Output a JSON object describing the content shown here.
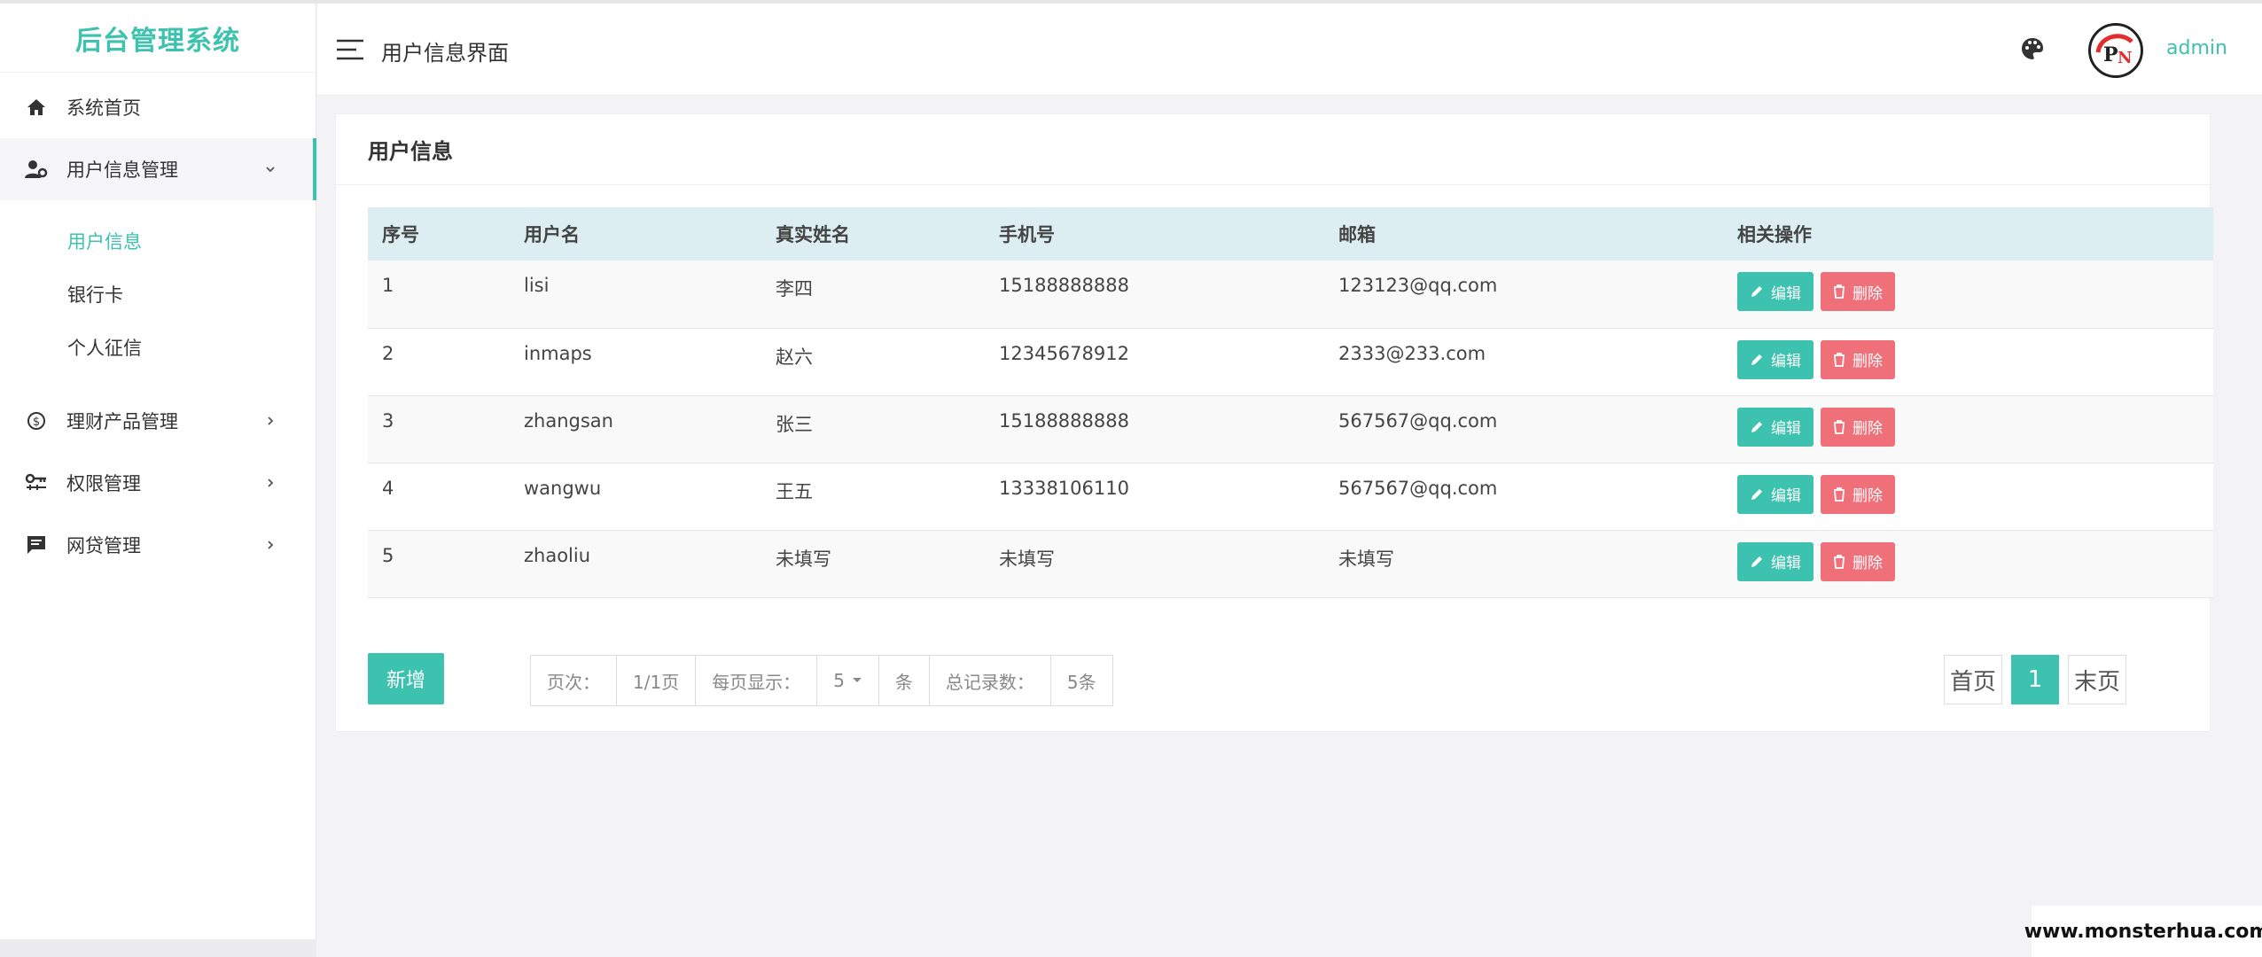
{
  "app": {
    "logo": "后台管理系统"
  },
  "colors": {
    "accent": "#3cc2ae",
    "danger": "#f0707a",
    "table_header": "#dceef2"
  },
  "sidebar": {
    "items": [
      {
        "label": "系统首页",
        "icon": "home-icon"
      },
      {
        "label": "用户信息管理",
        "icon": "user-settings-icon",
        "open": true,
        "children": [
          "用户信息",
          "银行卡",
          "个人征信"
        ],
        "active_child": "用户信息"
      },
      {
        "label": "理财产品管理",
        "icon": "money-icon"
      },
      {
        "label": "权限管理",
        "icon": "key-icon"
      },
      {
        "label": "网贷管理",
        "icon": "message-icon"
      }
    ]
  },
  "header": {
    "title": "用户信息界面",
    "user": "admin",
    "theme_icon": "palette-icon"
  },
  "card": {
    "title": "用户信息"
  },
  "table": {
    "columns": [
      "序号",
      "用户名",
      "真实姓名",
      "手机号",
      "邮箱",
      "相关操作"
    ],
    "rows": [
      [
        "1",
        "lisi",
        "李四",
        "15188888888",
        "123123@qq.com"
      ],
      [
        "2",
        "inmaps",
        "赵六",
        "12345678912",
        "2333@233.com"
      ],
      [
        "3",
        "zhangsan",
        "张三",
        "15188888888",
        "567567@qq.com"
      ],
      [
        "4",
        "wangwu",
        "王五",
        "13338106110",
        "567567@qq.com"
      ],
      [
        "5",
        "zhaoliu",
        "未填写",
        "未填写",
        "未填写"
      ]
    ],
    "edit_label": "编辑",
    "delete_label": "删除"
  },
  "footer": {
    "add_label": "新增",
    "page_label": "页次：",
    "page_value": "1/1页",
    "per_page_label": "每页显示：",
    "per_page_value": "5",
    "per_page_unit": "条",
    "total_label": "总记录数：",
    "total_value": "5条",
    "first_label": "首页",
    "current_page": "1",
    "last_label": "末页"
  },
  "watermark": "www.monsterhua.com"
}
